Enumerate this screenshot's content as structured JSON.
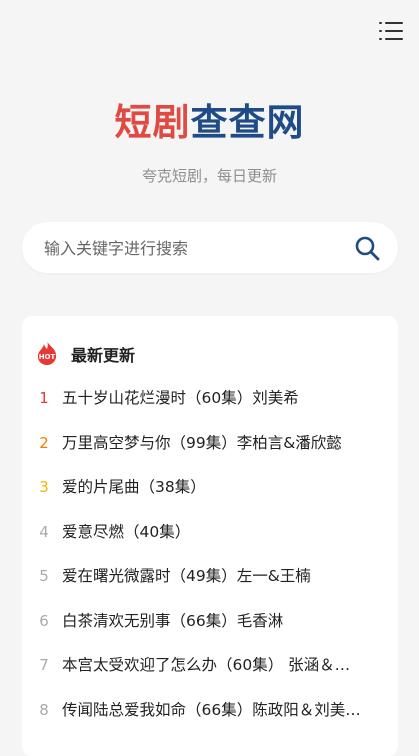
{
  "header": {
    "menu_icon": "list-menu-icon"
  },
  "logo": {
    "part1": "短剧",
    "part2": "查查网"
  },
  "tagline": "夸克短剧，每日更新",
  "search": {
    "placeholder": "输入关键字进行搜索",
    "value": "",
    "icon": "search-icon"
  },
  "latest": {
    "badge": "HOT",
    "title": "最新更新",
    "rank_colors": {
      "1": "#e53935",
      "2": "#f57c00",
      "3": "#f5b400",
      "other": "#aaaaaa"
    },
    "items": [
      {
        "rank": "1",
        "title": "五十岁山花烂漫时（60集）刘美希"
      },
      {
        "rank": "2",
        "title": "万里高空梦与你（99集）李柏言&潘欣懿"
      },
      {
        "rank": "3",
        "title": "爱的片尾曲（38集）"
      },
      {
        "rank": "4",
        "title": "爱意尽燃（40集）"
      },
      {
        "rank": "5",
        "title": "爱在曙光微露时（49集）左一&王楠"
      },
      {
        "rank": "6",
        "title": "白茶清欢无别事（66集）毛香淋"
      },
      {
        "rank": "7",
        "title": "本宫太受欢迎了怎么办（60集） 张涵＆…"
      },
      {
        "rank": "8",
        "title": "传闻陆总爱我如命（66集）陈政阳＆刘美…"
      }
    ]
  }
}
